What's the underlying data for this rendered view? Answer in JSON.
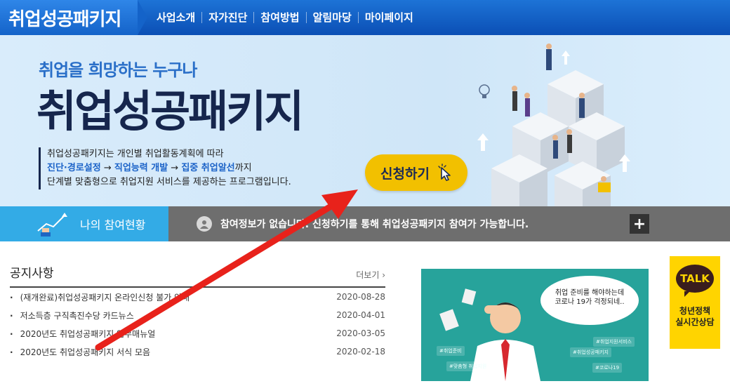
{
  "header": {
    "logo": "취업성공패키지",
    "menu": [
      "사업소개",
      "자가진단",
      "참여방법",
      "알림마당",
      "마이페이지"
    ]
  },
  "hero": {
    "subtitle": "취업을 희망하는 누구나",
    "title": "취업성공패키지",
    "desc_line1": "취업성공패키지는 개인별 취업활동계획에 따라",
    "desc_line2_a": "진단·경로설정",
    "desc_line2_arrow1": " → ",
    "desc_line2_b": "직업능력 개발",
    "desc_line2_arrow2": " → ",
    "desc_line2_c": "집중 취업알선",
    "desc_line2_d": "까지",
    "desc_line3": "단계별 맞춤형으로 취업지원 서비스를 제공하는 프로그램입니다.",
    "apply_button": "신청하기"
  },
  "status": {
    "label": "나의 참여현황",
    "message": "참여정보가 없습니다. 신청하기를 통해 취업성공패키지 참여가 가능합니다.",
    "plus": "+"
  },
  "notices": {
    "title": "공지사항",
    "more": "더보기",
    "items": [
      {
        "text": "(재개완료)취업성공패키지 온라인신청 불가 안내",
        "date": "2020-08-28"
      },
      {
        "text": "저소득층 구직촉진수당 카드뉴스",
        "date": "2020-04-01"
      },
      {
        "text": "2020년도 취업성공패키지 업무매뉴얼",
        "date": "2020-03-05"
      },
      {
        "text": "2020년도 취업성공패키지 서식 모음",
        "date": "2020-02-18"
      }
    ]
  },
  "card": {
    "bubble_line1": "취업 준비를 해야하는데",
    "bubble_line2": "코로나 19가 걱정되네..",
    "tags": [
      "#취업준비",
      "#취업지원서비스",
      "#취업성공패키지",
      "#맞춤형 취업지원",
      "#코로나19"
    ]
  },
  "talk": {
    "icon_text": "TALK",
    "label_line1": "청년정책",
    "label_line2": "실시간상담"
  },
  "colors": {
    "nav": "#0b4fb5",
    "accent_blue": "#33abe6",
    "apply_yellow": "#f2c000",
    "annotation_arrow": "#e8221b"
  }
}
